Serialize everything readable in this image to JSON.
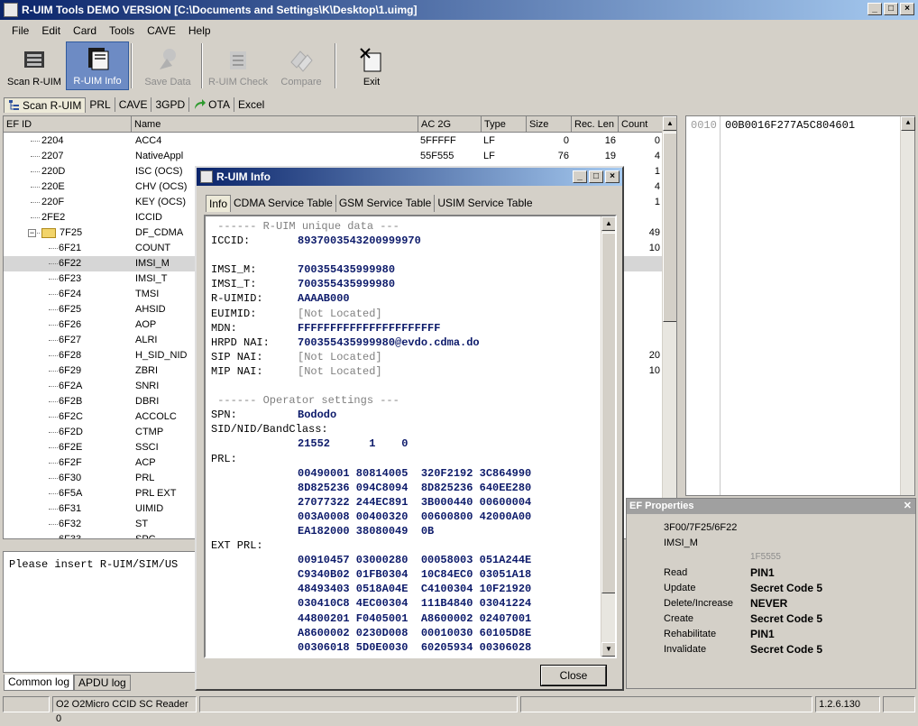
{
  "window": {
    "title": "R-UIM Tools DEMO VERSION [C:\\Documents and Settings\\K\\Desktop\\1.uimg]"
  },
  "menu": [
    "File",
    "Edit",
    "Card",
    "Tools",
    "CAVE",
    "Help"
  ],
  "toolbar": {
    "scan": "Scan R-UIM",
    "info": "R-UIM Info",
    "save": "Save Data",
    "check": "R-UIM Check",
    "compare": "Compare",
    "exit": "Exit"
  },
  "tabs": [
    "Scan R-UIM",
    "PRL",
    "CAVE",
    "3GPD",
    "OTA",
    "Excel"
  ],
  "list": {
    "headers": [
      "EF ID",
      "Name",
      "AC 2G",
      "Type",
      "Size",
      "Rec. Len",
      "Count"
    ],
    "rows": [
      {
        "id": "2204",
        "name": "ACC4",
        "ac": "5FFFFF",
        "type": "LF",
        "size": "0",
        "rec": "16",
        "count": "0"
      },
      {
        "id": "2207",
        "name": "NativeAppl",
        "ac": "55F555",
        "type": "LF",
        "size": "76",
        "rec": "19",
        "count": "4"
      },
      {
        "id": "220D",
        "name": "ISC (OCS)",
        "ac": "",
        "type": "",
        "size": "",
        "rec": "",
        "count": "1"
      },
      {
        "id": "220E",
        "name": "CHV (OCS)",
        "ac": "",
        "type": "",
        "size": "",
        "rec": "",
        "count": "4"
      },
      {
        "id": "220F",
        "name": "KEY (OCS)",
        "ac": "",
        "type": "",
        "size": "",
        "rec": "",
        "count": "1"
      },
      {
        "id": "2FE2",
        "name": "ICCID",
        "ac": "",
        "type": "",
        "size": "",
        "rec": "",
        "count": ""
      },
      {
        "id": "7F25",
        "name": "DF_CDMA",
        "ac": "",
        "type": "",
        "size": "",
        "rec": "",
        "count": "49"
      },
      {
        "id": "6F21",
        "name": "COUNT",
        "ac": "",
        "type": "",
        "size": "",
        "rec": "",
        "count": "10"
      },
      {
        "id": "6F22",
        "name": "IMSI_M",
        "ac": "",
        "type": "",
        "size": "",
        "rec": "",
        "count": ""
      },
      {
        "id": "6F23",
        "name": "IMSI_T",
        "ac": "",
        "type": "",
        "size": "",
        "rec": "",
        "count": ""
      },
      {
        "id": "6F24",
        "name": "TMSI",
        "ac": "",
        "type": "",
        "size": "",
        "rec": "",
        "count": ""
      },
      {
        "id": "6F25",
        "name": "AHSID",
        "ac": "",
        "type": "",
        "size": "",
        "rec": "",
        "count": ""
      },
      {
        "id": "6F26",
        "name": "AOP",
        "ac": "",
        "type": "",
        "size": "",
        "rec": "",
        "count": ""
      },
      {
        "id": "6F27",
        "name": "ALRI",
        "ac": "",
        "type": "",
        "size": "",
        "rec": "",
        "count": ""
      },
      {
        "id": "6F28",
        "name": "H_SID_NID",
        "ac": "",
        "type": "",
        "size": "",
        "rec": "",
        "count": "20"
      },
      {
        "id": "6F29",
        "name": "ZBRI",
        "ac": "",
        "type": "",
        "size": "",
        "rec": "",
        "count": "10"
      },
      {
        "id": "6F2A",
        "name": "SNRI",
        "ac": "",
        "type": "",
        "size": "",
        "rec": "",
        "count": ""
      },
      {
        "id": "6F2B",
        "name": "DBRI",
        "ac": "",
        "type": "",
        "size": "",
        "rec": "",
        "count": ""
      },
      {
        "id": "6F2C",
        "name": "ACCOLC",
        "ac": "",
        "type": "",
        "size": "",
        "rec": "",
        "count": ""
      },
      {
        "id": "6F2D",
        "name": "CTMP",
        "ac": "",
        "type": "",
        "size": "",
        "rec": "",
        "count": ""
      },
      {
        "id": "6F2E",
        "name": "SSCI",
        "ac": "",
        "type": "",
        "size": "",
        "rec": "",
        "count": ""
      },
      {
        "id": "6F2F",
        "name": "ACP",
        "ac": "",
        "type": "",
        "size": "",
        "rec": "",
        "count": ""
      },
      {
        "id": "6F30",
        "name": "PRL",
        "ac": "",
        "type": "",
        "size": "",
        "rec": "",
        "count": ""
      },
      {
        "id": "6F5A",
        "name": "PRL EXT",
        "ac": "",
        "type": "",
        "size": "",
        "rec": "",
        "count": ""
      },
      {
        "id": "6F31",
        "name": "UIMID",
        "ac": "",
        "type": "",
        "size": "",
        "rec": "",
        "count": ""
      },
      {
        "id": "6F32",
        "name": "ST",
        "ac": "",
        "type": "",
        "size": "",
        "rec": "",
        "count": ""
      },
      {
        "id": "6F33",
        "name": "SPC",
        "ac": "",
        "type": "",
        "size": "",
        "rec": "",
        "count": ""
      }
    ]
  },
  "hex": {
    "offset": "0010",
    "data": "00B0016F277A5C804601"
  },
  "ef_properties": {
    "title": "EF Properties",
    "path": "3F00/7F25/6F22",
    "name": "IMSI_M",
    "fid": "1F5555",
    "access": [
      {
        "op": "Read",
        "cond": "PIN1"
      },
      {
        "op": "Update",
        "cond": "Secret Code 5"
      },
      {
        "op": "Delete/Increase",
        "cond": "NEVER"
      },
      {
        "op": "Create",
        "cond": "Secret Code 5"
      },
      {
        "op": "Rehabilitate",
        "cond": "PIN1"
      },
      {
        "op": "Invalidate",
        "cond": "Secret Code 5"
      }
    ]
  },
  "log": {
    "text": "Please insert R-UIM/SIM/US",
    "tabs": [
      "Common log",
      "APDU log"
    ]
  },
  "status": {
    "reader": "O2 O2Micro CCID SC Reader 0",
    "version": "1.2.6.130"
  },
  "dialog": {
    "title": "R-UIM Info",
    "tabs": [
      "Info",
      "CDMA Service Table",
      "GSM Service Table",
      "USIM Service Table"
    ],
    "close": "Close",
    "lines": [
      {
        "l": " ------ R-UIM unique data ---",
        "v": "",
        "s": "g"
      },
      {
        "l": "ICCID:",
        "v": "8937003543200999970",
        "s": "b"
      },
      {
        "l": "",
        "v": "",
        "s": ""
      },
      {
        "l": "IMSI_M:",
        "v": "700355435999980",
        "s": "b"
      },
      {
        "l": "IMSI_T:",
        "v": "700355435999980",
        "s": "b"
      },
      {
        "l": "R-UIMID:",
        "v": "AAAAB000",
        "s": "b"
      },
      {
        "l": "EUIMID:",
        "v": "[Not Located]",
        "s": "g"
      },
      {
        "l": "MDN:",
        "v": "FFFFFFFFFFFFFFFFFFFFFF",
        "s": "b"
      },
      {
        "l": "HRPD NAI:",
        "v": "700355435999980@evdo.cdma.do",
        "s": "b"
      },
      {
        "l": "SIP NAI:",
        "v": "[Not Located]",
        "s": "g"
      },
      {
        "l": "MIP NAI:",
        "v": "[Not Located]",
        "s": "g"
      },
      {
        "l": "",
        "v": "",
        "s": ""
      },
      {
        "l": " ------ Operator settings ---",
        "v": "",
        "s": "g"
      },
      {
        "l": "SPN:",
        "v": "Bododo",
        "s": "b"
      },
      {
        "l": "SID/NID/BandClass:",
        "v": "",
        "s": ""
      },
      {
        "l": "",
        "v": "21552      1    0",
        "s": "b"
      },
      {
        "l": "PRL:",
        "v": "",
        "s": ""
      },
      {
        "l": "",
        "v": "00490001 80814005  320F2192 3C864990",
        "s": "b"
      },
      {
        "l": "",
        "v": "8D825236 094C8094  8D825236 640EE280",
        "s": "b"
      },
      {
        "l": "",
        "v": "27077322 244EC891  3B000440 00600004",
        "s": "b"
      },
      {
        "l": "",
        "v": "003A0008 00400320  00600800 42000A00",
        "s": "b"
      },
      {
        "l": "",
        "v": "EA182000 38080049  0B",
        "s": "b"
      },
      {
        "l": "EXT PRL:",
        "v": "",
        "s": ""
      },
      {
        "l": "",
        "v": "00910457 03000280  00058003 051A244E",
        "s": "b"
      },
      {
        "l": "",
        "v": "C9340B02 01FB0304  10C84EC0 03051A18",
        "s": "b"
      },
      {
        "l": "",
        "v": "48493403 0518A04E  C4100304 10F21920",
        "s": "b"
      },
      {
        "l": "",
        "v": "030410C8 4EC00304  111B4840 03041224",
        "s": "b"
      },
      {
        "l": "",
        "v": "44800201 F0405001  A8600002 02407001",
        "s": "b"
      },
      {
        "l": "",
        "v": "A8600002 0230D008  00010030 60105D8E",
        "s": "b"
      },
      {
        "l": "",
        "v": "00306018 5D0E0030  60205934 00306028",
        "s": "b"
      }
    ]
  }
}
